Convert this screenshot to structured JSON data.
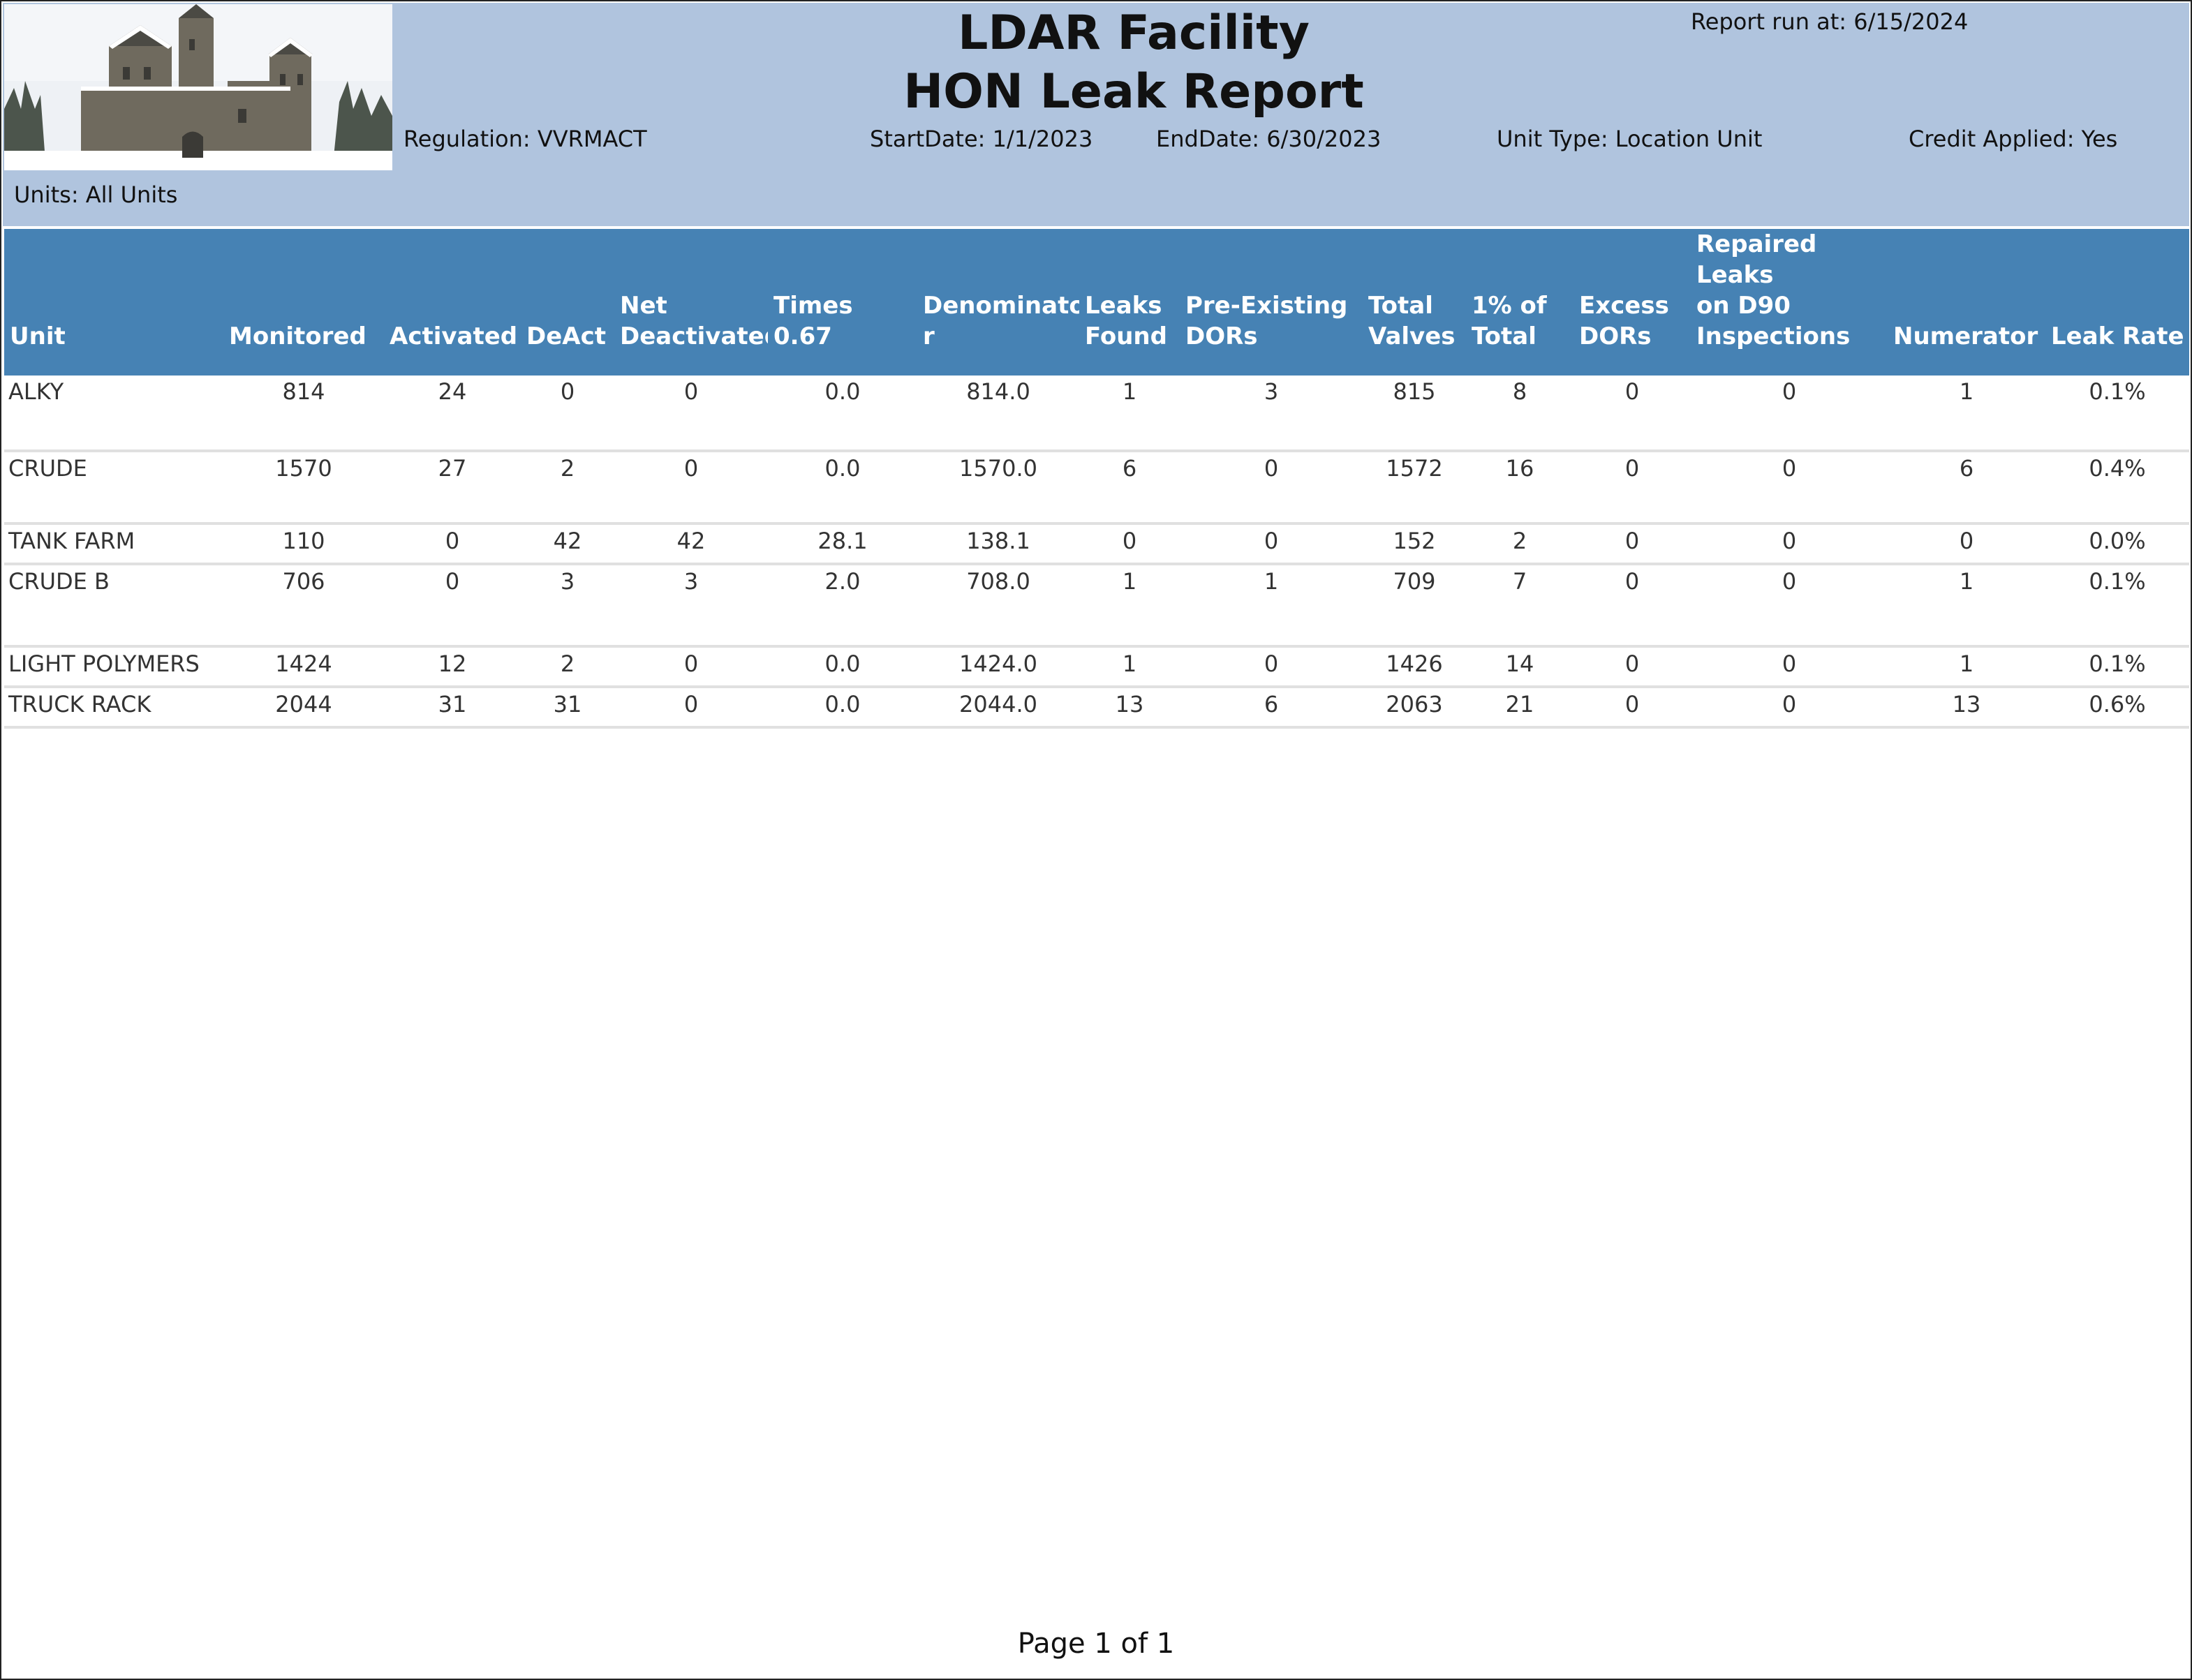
{
  "header": {
    "title_line1": "LDAR Facility",
    "title_line2": "HON Leak Report",
    "report_run_at": "Report run at: 6/15/2024",
    "regulation": "Regulation: VVRMACT",
    "start_date": "StartDate: 1/1/2023",
    "end_date": "EndDate: 6/30/2023",
    "unit_type": "Unit Type: Location Unit",
    "credit_applied": "Credit Applied: Yes",
    "units": "Units: All Units"
  },
  "table": {
    "columns": [
      "Unit",
      "Monitored",
      "Activated",
      "DeAct",
      "Net\nDeactivated",
      "Times 0.67",
      "Denominato\nr",
      "Leaks\nFound",
      "Pre-Existing\nDORs",
      "Total\nValves",
      "1% of\nTotal",
      "Excess\nDORs",
      "Repaired Leaks\non D90\nInspections",
      "Numerator",
      "Leak Rate"
    ],
    "rows": [
      [
        "ALKY",
        "814",
        "24",
        "0",
        "0",
        "0.0",
        "814.0",
        "1",
        "3",
        "815",
        "8",
        "0",
        "0",
        "1",
        "0.1%"
      ],
      [
        "CRUDE",
        "1570",
        "27",
        "2",
        "0",
        "0.0",
        "1570.0",
        "6",
        "0",
        "1572",
        "16",
        "0",
        "0",
        "6",
        "0.4%"
      ],
      [
        "TANK FARM",
        "110",
        "0",
        "42",
        "42",
        "28.1",
        "138.1",
        "0",
        "0",
        "152",
        "2",
        "0",
        "0",
        "0",
        "0.0%"
      ],
      [
        "CRUDE B",
        "706",
        "0",
        "3",
        "3",
        "2.0",
        "708.0",
        "1",
        "1",
        "709",
        "7",
        "0",
        "0",
        "1",
        "0.1%"
      ],
      [
        "LIGHT POLYMERS",
        "1424",
        "12",
        "2",
        "0",
        "0.0",
        "1424.0",
        "1",
        "0",
        "1426",
        "14",
        "0",
        "0",
        "1",
        "0.1%"
      ],
      [
        "TRUCK RACK",
        "2044",
        "31",
        "31",
        "0",
        "0.0",
        "2044.0",
        "13",
        "6",
        "2063",
        "21",
        "0",
        "0",
        "13",
        "0.6%"
      ]
    ]
  },
  "footer": {
    "page_label": "Page 1 of 1"
  },
  "colors": {
    "banner": "#b0c4de",
    "header_row": "#4682b4",
    "row_divider": "#e0e0e0"
  }
}
